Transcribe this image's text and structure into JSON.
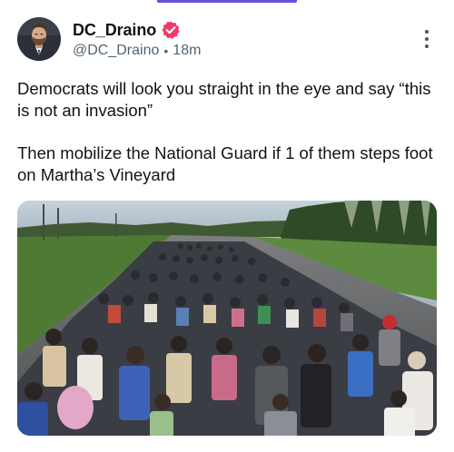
{
  "post": {
    "author": {
      "display_name": "DC_Draino",
      "handle": "@DC_Draino",
      "verified": true,
      "verified_badge_color": "#f0386b"
    },
    "timestamp": "18m",
    "separator": "•",
    "text_paragraphs": [
      "Democrats will look you straight in the eye and say “this is not an invasion”",
      "Then mobilize the National Guard if 1 of them steps foot on Martha’s Vineyard"
    ],
    "media": {
      "icon": "photo-of-crowd-walking-on-highway"
    }
  },
  "icons": {
    "more": "vertical-ellipsis-icon",
    "verified": "verified-badge-icon"
  },
  "colors": {
    "accent_indicator": "#6b4fd8",
    "secondary_text": "#536471",
    "primary_text": "#0f1419"
  }
}
